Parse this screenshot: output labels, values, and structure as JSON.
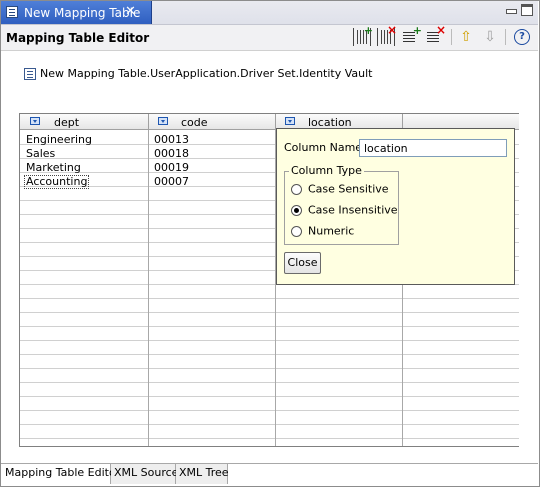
{
  "tab": {
    "title": "New Mapping Table",
    "close": "✕"
  },
  "editor": {
    "title": "Mapping Table Editor"
  },
  "toolbar": {
    "up_glyph": "⇧",
    "down_glyph": "⇩",
    "help_glyph": "?"
  },
  "path": "New Mapping Table.UserApplication.Driver Set.Identity Vault",
  "table": {
    "columns": [
      {
        "label": "dept"
      },
      {
        "label": "code"
      },
      {
        "label": "location"
      },
      {
        "label": ""
      }
    ],
    "rows": [
      [
        "Engineering",
        "00013"
      ],
      [
        "Sales",
        "00018"
      ],
      [
        "Marketing",
        "00019"
      ],
      [
        "Accounting",
        "00007"
      ]
    ]
  },
  "popup": {
    "column_name_label": "Column Name:",
    "column_name_value": "location",
    "column_type_label": "Column Type",
    "options": [
      {
        "label": "Case Sensitive",
        "selected": false
      },
      {
        "label": "Case Insensitive",
        "selected": true
      },
      {
        "label": "Numeric",
        "selected": false
      }
    ],
    "close_label": "Close"
  },
  "bottom_tabs": [
    {
      "label": "Mapping Table Editor",
      "active": true
    },
    {
      "label": "XML Source",
      "active": false
    },
    {
      "label": "XML Tree",
      "active": false
    }
  ],
  "colors": {
    "tab_active": "#3a6bd0",
    "popup_bg": "#ffffe1",
    "grid_line": "#d0d0d0"
  }
}
